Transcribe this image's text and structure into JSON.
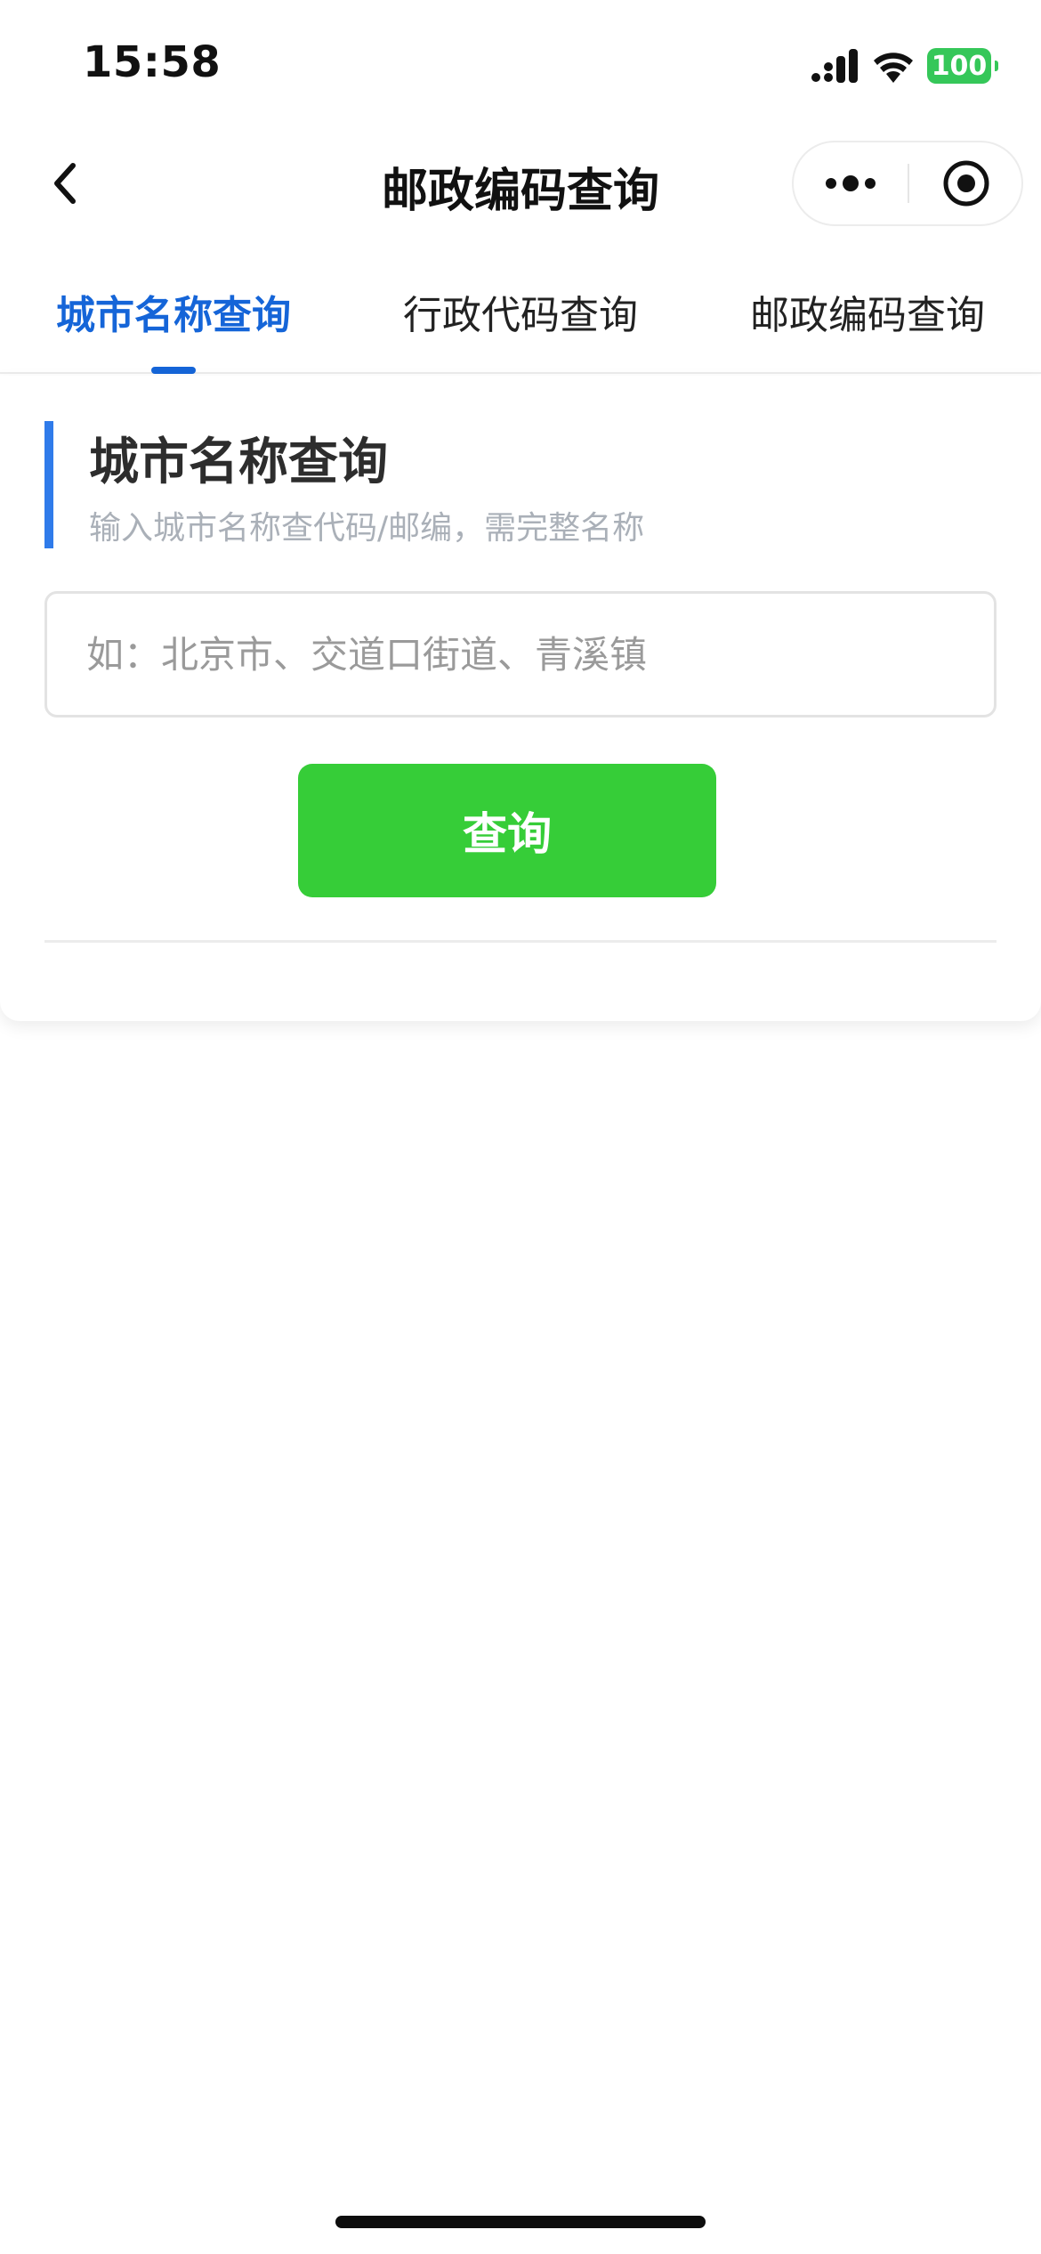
{
  "status_bar": {
    "time": "15:58",
    "battery": "100"
  },
  "nav": {
    "title": "邮政编码查询"
  },
  "tabs": [
    {
      "label": "城市名称查询",
      "active": true
    },
    {
      "label": "行政代码查询",
      "active": false
    },
    {
      "label": "邮政编码查询",
      "active": false
    }
  ],
  "section": {
    "title": "城市名称查询",
    "subtitle": "输入城市名称查代码/邮编，需完整名称"
  },
  "search": {
    "value": "",
    "placeholder": "如：北京市、交道口街道、青溪镇"
  },
  "query_button": {
    "label": "查询"
  },
  "colors": {
    "accent_blue": "#1565d8",
    "section_bar_blue": "#2f7bea",
    "button_green": "#36cd38",
    "battery_green": "#35c759"
  },
  "icons": [
    "cellular-signal-icon",
    "wifi-icon",
    "battery-icon",
    "back-chevron-icon",
    "more-dots-icon",
    "close-circle-icon"
  ]
}
